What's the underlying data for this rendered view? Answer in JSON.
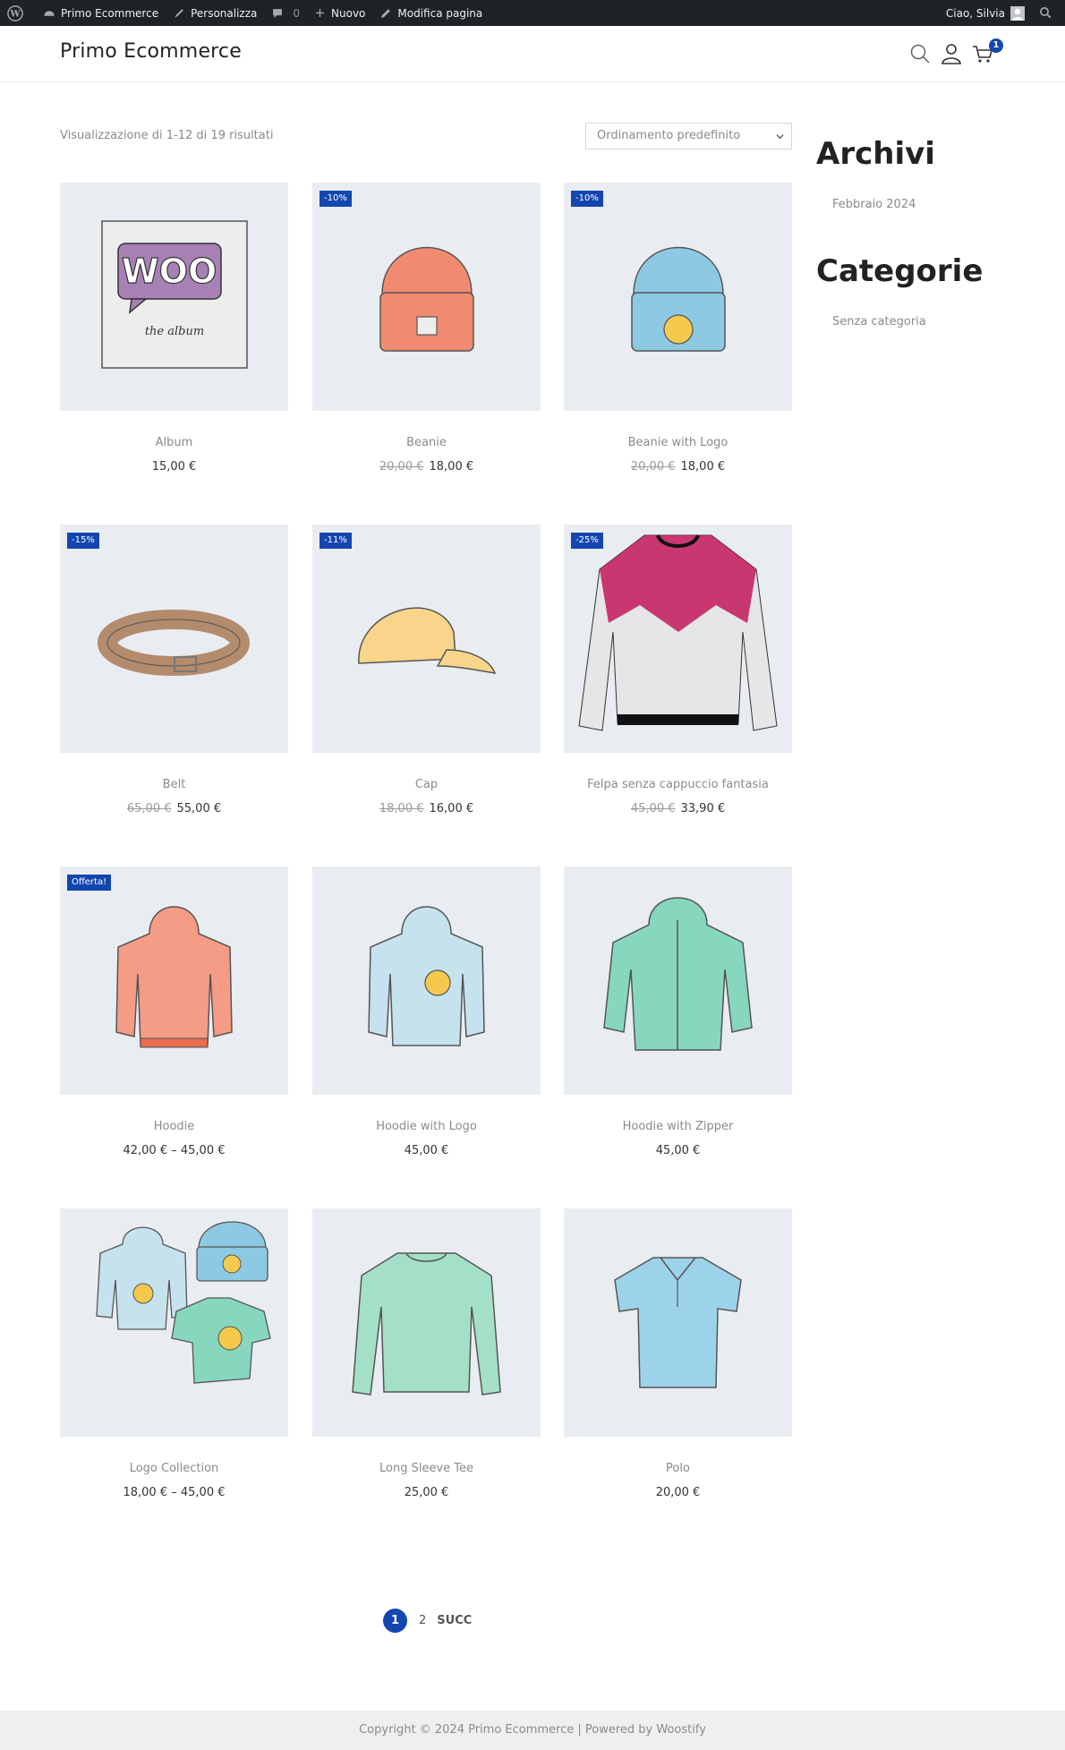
{
  "admin_bar": {
    "site_name": "Primo Ecommerce",
    "customize": "Personalizza",
    "comments_count": "0",
    "new": "Nuovo",
    "edit_page": "Modifica pagina",
    "greeting": "Ciao, Silvia"
  },
  "header": {
    "site_title": "Primo Ecommerce",
    "cart_count": "1"
  },
  "toolbar": {
    "result_count": "Visualizzazione di 1-12 di 19 risultati",
    "orderby_selected": "Ordinamento predefinito"
  },
  "products": [
    {
      "name": "Album",
      "price": "15,00 €",
      "old_price": "",
      "badge": ""
    },
    {
      "name": "Beanie",
      "price": "18,00 €",
      "old_price": "20,00 €",
      "badge": "-10%"
    },
    {
      "name": "Beanie with Logo",
      "price": "18,00 €",
      "old_price": "20,00 €",
      "badge": "-10%"
    },
    {
      "name": "Belt",
      "price": "55,00 €",
      "old_price": "65,00 €",
      "badge": "-15%"
    },
    {
      "name": "Cap",
      "price": "16,00 €",
      "old_price": "18,00 €",
      "badge": "-11%"
    },
    {
      "name": "Felpa senza cappuccio fantasia",
      "price": "33,90 €",
      "old_price": "45,00 €",
      "badge": "-25%"
    },
    {
      "name": "Hoodie",
      "price": "42,00 € – 45,00 €",
      "old_price": "",
      "badge": "Offerta!"
    },
    {
      "name": "Hoodie with Logo",
      "price": "45,00 €",
      "old_price": "",
      "badge": ""
    },
    {
      "name": "Hoodie with Zipper",
      "price": "45,00 €",
      "old_price": "",
      "badge": ""
    },
    {
      "name": "Logo Collection",
      "price": "18,00 € – 45,00 €",
      "old_price": "",
      "badge": ""
    },
    {
      "name": "Long Sleeve Tee",
      "price": "25,00 €",
      "old_price": "",
      "badge": ""
    },
    {
      "name": "Polo",
      "price": "20,00 €",
      "old_price": "",
      "badge": ""
    }
  ],
  "album_art": {
    "word": "WOO",
    "caption": "the album"
  },
  "sidebar": {
    "archives_title": "Archivi",
    "archives_link": "Febbraio 2024",
    "categories_title": "Categorie",
    "categories_link": "Senza categoria"
  },
  "pagination": {
    "current": "1",
    "page2": "2",
    "next": "SUCC"
  },
  "footer": {
    "text": "Copyright © 2024 Primo Ecommerce | Powered by Woostify"
  },
  "colors": {
    "accent": "#1346af",
    "admin_bar": "#1d2327",
    "thumb_bg": "#e9edf1"
  }
}
